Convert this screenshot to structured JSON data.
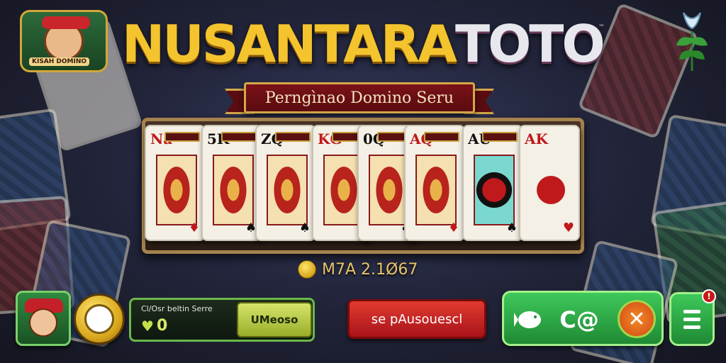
{
  "logo": {
    "title_main": "NUSANTARA",
    "title_suffix": "TOTO",
    "trademark": "™",
    "mascot_tag": "KISAH DOMINO"
  },
  "banner": {
    "text": "Perngìnao Domino Seru"
  },
  "cards": [
    {
      "rank": "Na",
      "pip": "♦",
      "color": "red"
    },
    {
      "rank": "5K",
      "pip": "♠",
      "color": "black"
    },
    {
      "rank": "ZQ",
      "pip": "♠",
      "color": "black"
    },
    {
      "rank": "KG",
      "pip": "♥",
      "color": "red"
    },
    {
      "rank": "0Q",
      "pip": "♣",
      "color": "black"
    },
    {
      "rank": "AQ",
      "pip": "♦",
      "color": "red"
    },
    {
      "rank": "AU",
      "pip": "♠",
      "color": "black"
    },
    {
      "rank": "AK",
      "pip": "♥",
      "color": "red"
    }
  ],
  "score": {
    "text": "M7A 2.1Ø67"
  },
  "bottom": {
    "info_label": "Cl/Osr beltin  Serre",
    "info_value": "0",
    "menu_button": "UMeoso",
    "play_button": "se pAusouescl",
    "tool_middle": "C@",
    "notification_count": "!"
  },
  "colors": {
    "gold": "#f4c42e",
    "banner_red": "#7a1218",
    "green_panel": "#3ec85a",
    "play_red": "#e23a30"
  }
}
